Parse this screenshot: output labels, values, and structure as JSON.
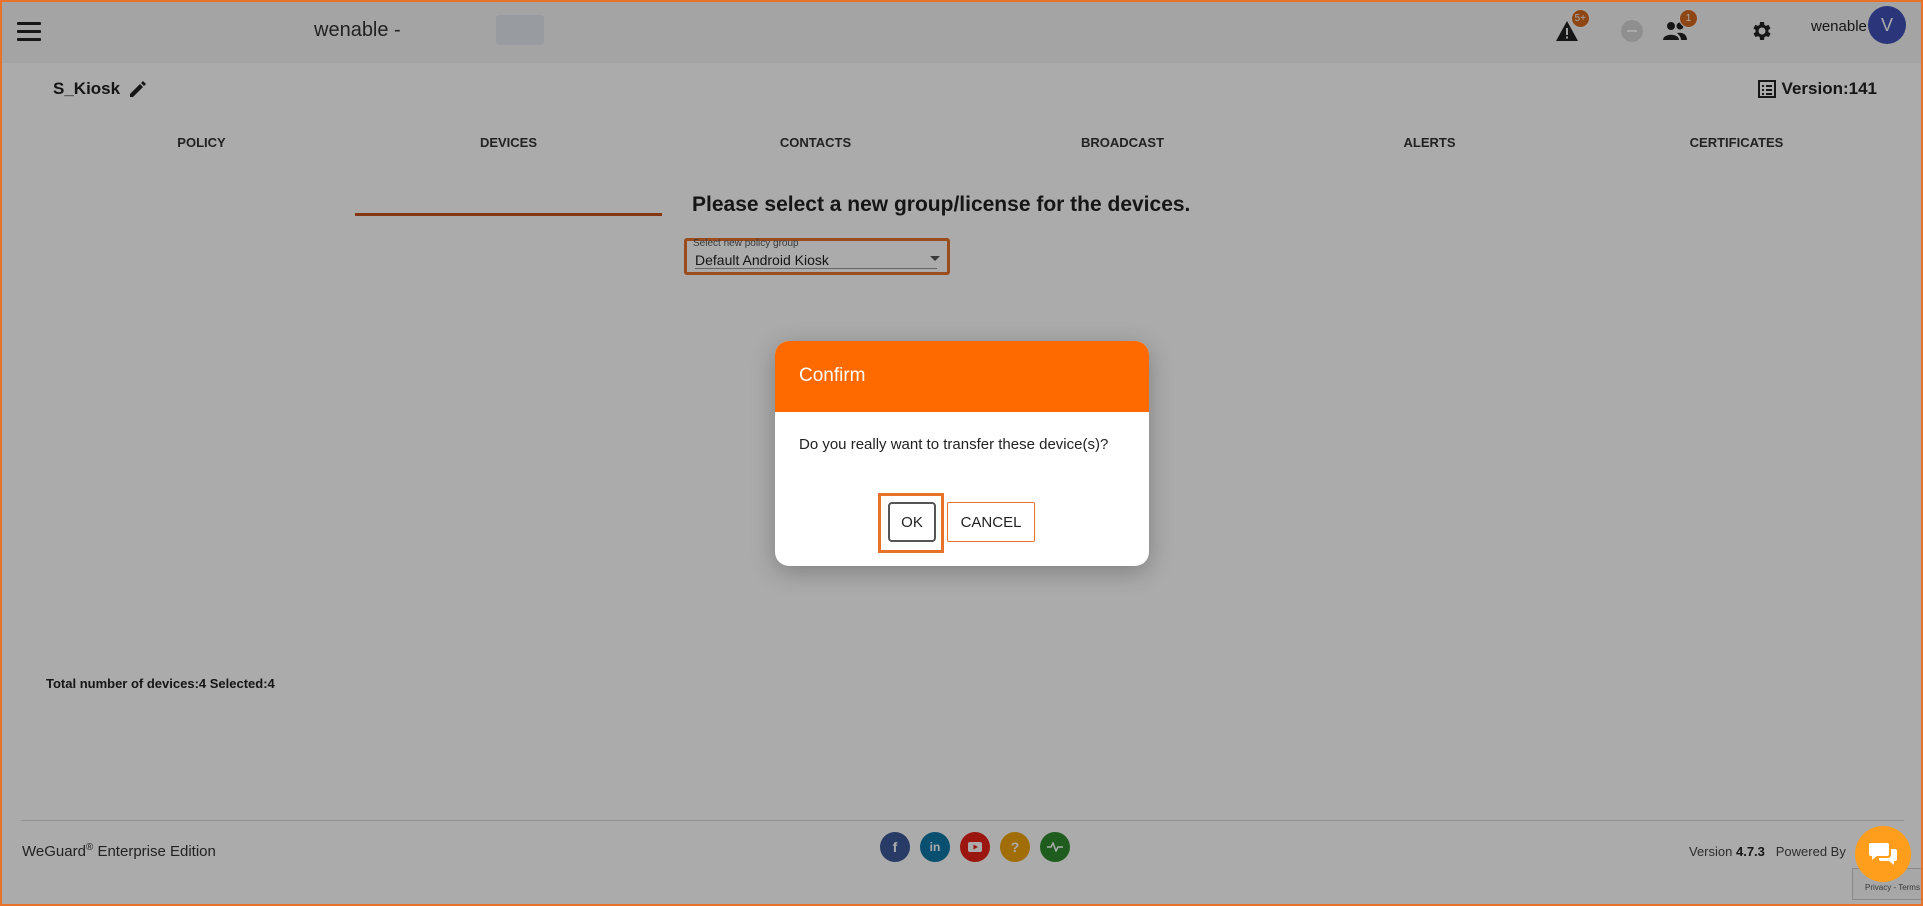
{
  "header": {
    "app_title": "wenable -",
    "alerts_badge": "5+",
    "users_badge": "1",
    "user_name": "wenable",
    "avatar_initial": "V"
  },
  "policy": {
    "name": "S_Kiosk",
    "version": "Version:141"
  },
  "tabs": [
    {
      "label": "POLICY",
      "active": false
    },
    {
      "label": "DEVICES",
      "active": true
    },
    {
      "label": "CONTACTS",
      "active": false
    },
    {
      "label": "BROADCAST",
      "active": false
    },
    {
      "label": "ALERTS",
      "active": false
    },
    {
      "label": "CERTIFICATES",
      "active": false
    }
  ],
  "main": {
    "section_title": "Please select a new group/license for the devices.",
    "select_label": "Select new policy group",
    "select_value": "Default Android Kiosk",
    "totals": "Total number of devices:4  Selected:4"
  },
  "dialog": {
    "title": "Confirm",
    "message": "Do you really want to transfer these device(s)?",
    "ok_label": "OK",
    "cancel_label": "CANCEL"
  },
  "footer": {
    "edition_name": "WeGuard",
    "edition_suffix": " Enterprise Edition",
    "version_prefix": "Version ",
    "version_number": "4.7.3",
    "powered_by": "Powered By",
    "recaptcha_text": "Privacy - Terms",
    "social": [
      "facebook-icon",
      "linkedin-icon",
      "youtube-icon",
      "help-icon",
      "activity-icon"
    ]
  },
  "colors": {
    "accent": "#ff6a00",
    "tab_underline": "#c7521c",
    "facebook": "#3b5998",
    "linkedin": "#0e76a8",
    "youtube": "#e62117",
    "help": "#f0a30a",
    "activity": "#2e8b2e"
  }
}
